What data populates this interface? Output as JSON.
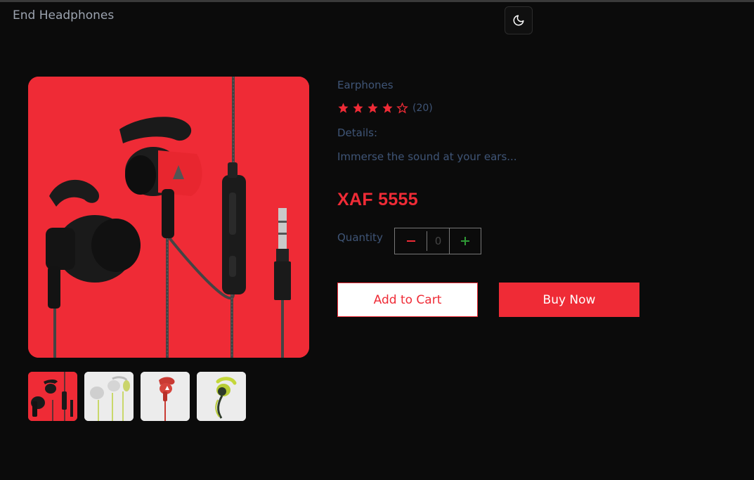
{
  "header": {
    "brand": "End Headphones",
    "theme_toggle_icon": "moon-icon"
  },
  "product": {
    "category": "Earphones",
    "rating": 4,
    "rating_max": 5,
    "review_count": "(20)",
    "details_label": "Details:",
    "description": "Immerse the sound at your ears...",
    "price": "XAF 5555",
    "quantity_label": "Quantity",
    "quantity_value": "0"
  },
  "gallery": {
    "selected_index": 0,
    "thumbnails": [
      "black-red earphones",
      "white-green earphones",
      "red earphones",
      "green earphones"
    ]
  },
  "actions": {
    "add_to_cart": "Add to Cart",
    "buy_now": "Buy Now"
  },
  "colors": {
    "accent": "#ef2b36",
    "background": "#0b0b0b",
    "muted_text": "#3f5577",
    "brand_text": "#9ca3af",
    "plus_icon": "#2e9a35"
  }
}
